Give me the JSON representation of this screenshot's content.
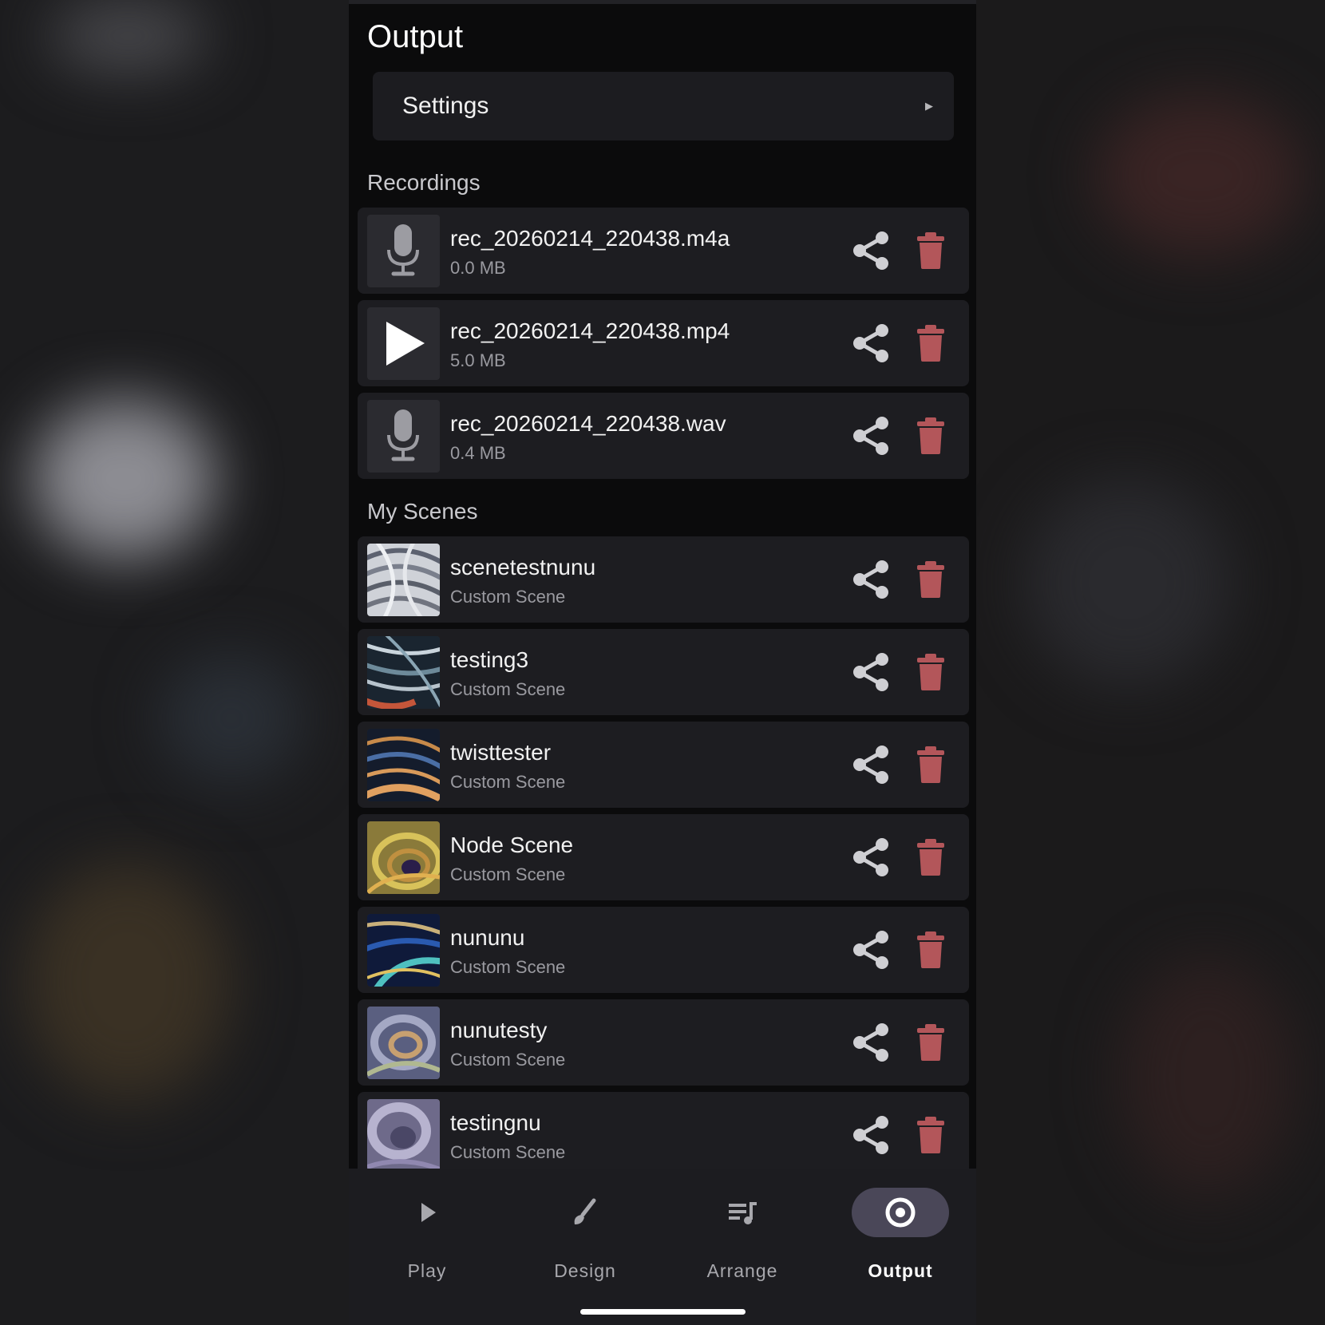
{
  "header": {
    "title": "Output"
  },
  "settings": {
    "label": "Settings",
    "icon": "chevron-right-icon"
  },
  "recordings": {
    "title": "Recordings",
    "items": [
      {
        "name": "rec_20260214_220438.m4a",
        "size": "0.0 MB",
        "icon": "microphone-icon"
      },
      {
        "name": "rec_20260214_220438.mp4",
        "size": "5.0 MB",
        "icon": "play-icon"
      },
      {
        "name": "rec_20260214_220438.wav",
        "size": "0.4 MB",
        "icon": "microphone-icon"
      }
    ]
  },
  "scenes": {
    "title": "My Scenes",
    "items": [
      {
        "name": "scenetestnunu",
        "type": "Custom Scene"
      },
      {
        "name": "testing3",
        "type": "Custom Scene"
      },
      {
        "name": "twisttester",
        "type": "Custom Scene"
      },
      {
        "name": "Node Scene",
        "type": "Custom Scene"
      },
      {
        "name": "nununu",
        "type": "Custom Scene"
      },
      {
        "name": "nunutesty",
        "type": "Custom Scene"
      },
      {
        "name": "testingnu",
        "type": "Custom Scene"
      }
    ]
  },
  "nav": {
    "items": [
      {
        "label": "Play",
        "icon": "play-icon"
      },
      {
        "label": "Design",
        "icon": "brush-icon"
      },
      {
        "label": "Arrange",
        "icon": "playlist-icon"
      },
      {
        "label": "Output",
        "icon": "record-icon"
      }
    ],
    "active": "Output"
  },
  "colors": {
    "background": "#0b0b0c",
    "card": "#1d1d21",
    "share_icon": "#cfcfd3",
    "delete_icon": "#b3565a",
    "nav_active_pill": "#4a4758"
  }
}
